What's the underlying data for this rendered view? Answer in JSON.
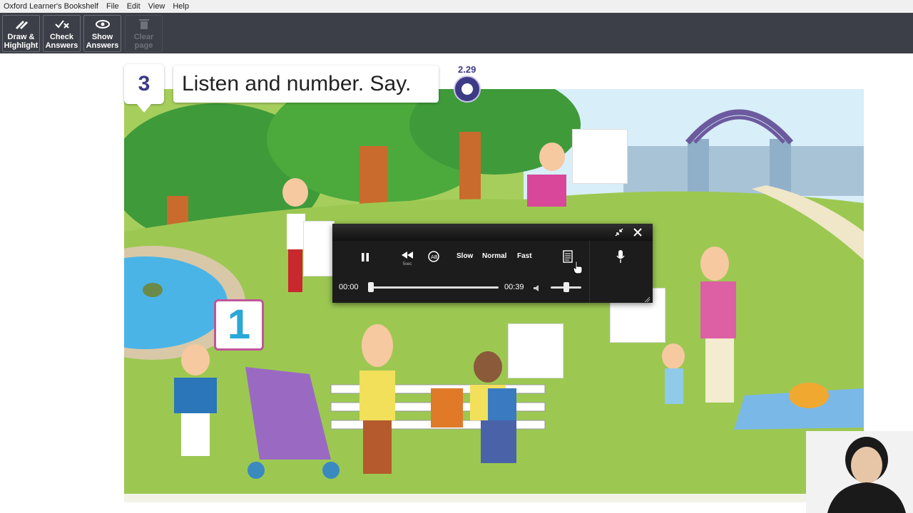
{
  "menu": {
    "app_title": "Oxford Learner's Bookshelf",
    "items": [
      "File",
      "Edit",
      "View",
      "Help"
    ]
  },
  "toolbar": {
    "buttons": [
      {
        "line1": "Draw &",
        "line2": "Highlight",
        "icon": "pen-icon"
      },
      {
        "line1": "Check",
        "line2": "Answers",
        "icon": "check-x-icon"
      },
      {
        "line1": "Show",
        "line2": "Answers",
        "icon": "eye-icon"
      },
      {
        "line1": "Clear",
        "line2": "page",
        "icon": "trash-icon"
      }
    ]
  },
  "activity": {
    "number": "3",
    "instruction": "Listen and number. Say.",
    "track": "2.29",
    "example_answer": "1"
  },
  "player": {
    "speed_slow": "Slow",
    "speed_normal": "Normal",
    "speed_fast": "Fast",
    "rewind_label": "5sec",
    "current_time": "00:00",
    "total_time": "00:39",
    "progress": 0.0,
    "volume": 0.5
  },
  "colors": {
    "toolbar_bg": "#3d3f48",
    "accent_purple": "#3d3a86",
    "card_pink": "#c0569a",
    "number_blue": "#2aa8d8"
  }
}
